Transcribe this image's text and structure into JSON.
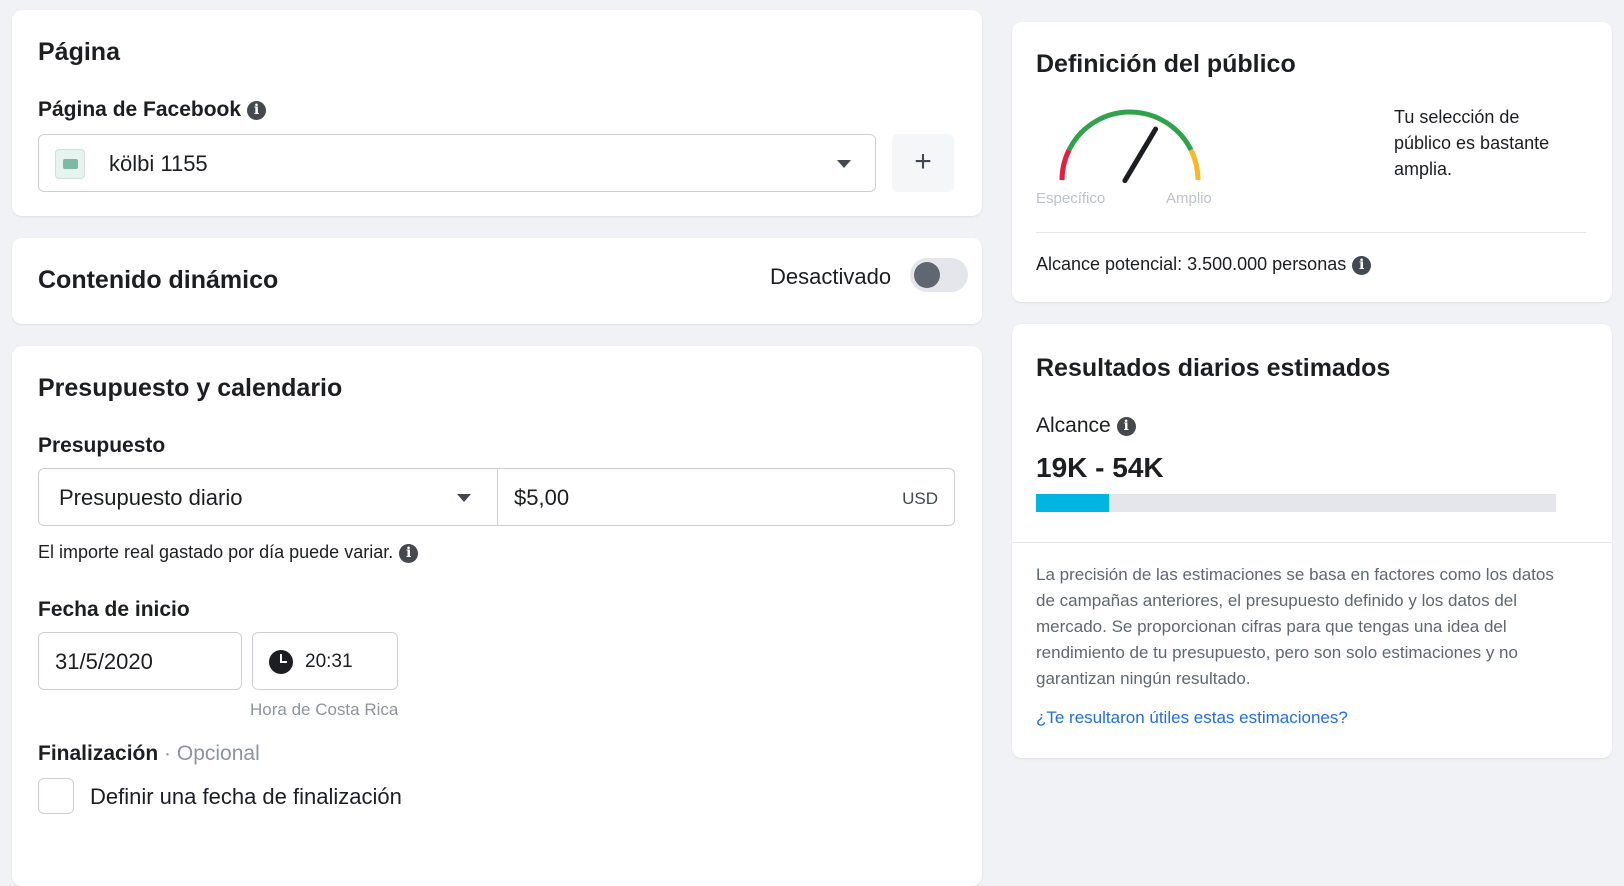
{
  "pagina": {
    "title": "Página",
    "fb_label": "Página de Facebook",
    "fb_value": "kölbi 1155",
    "add_label": "+"
  },
  "dinamico": {
    "title": "Contenido dinámico",
    "toggle_label": "Desactivado",
    "toggle_on": false
  },
  "presupuesto": {
    "title": "Presupuesto y calendario",
    "budget_label": "Presupuesto",
    "budget_type": "Presupuesto diario",
    "amount": "$5,00",
    "currency": "USD",
    "note": "El importe real gastado por día puede variar.",
    "start_label": "Fecha de inicio",
    "start_date": "31/5/2020",
    "start_time": "20:31",
    "timezone": "Hora de Costa Rica",
    "end_label": "Finalización",
    "end_optional": "· Opcional",
    "end_checkbox": "Definir una fecha de finalización"
  },
  "publico": {
    "title": "Definición del público",
    "gauge_left": "Específico",
    "gauge_right": "Amplio",
    "gauge_level": 0.72,
    "selection_text": "Tu selección de público es bastante amplia.",
    "reach": "Alcance potencial: 3.500.000 personas",
    "colors": {
      "red": "#e41e3f",
      "green": "#31a24c",
      "orange": "#f7b928"
    }
  },
  "resultados": {
    "title": "Resultados diarios estimados",
    "reach_label": "Alcance",
    "reach_range": "19K - 54K",
    "bar_fill": 0.14,
    "bar_color": "#00b5e2",
    "description": "La precisión de las estimaciones se basa en factores como los datos de campañas anteriores, el presupuesto definido y los datos del mercado. Se proporcionan cifras para que tengas una idea del rendimiento de tu presupuesto, pero son solo estimaciones y no garantizan ningún resultado.",
    "feedback_link": "¿Te resultaron útiles estas estimaciones?"
  },
  "icons": {
    "info": "info-icon",
    "clock": "clock-icon",
    "page": "page-thumbnail-icon",
    "caret": "chevron-down-icon"
  }
}
